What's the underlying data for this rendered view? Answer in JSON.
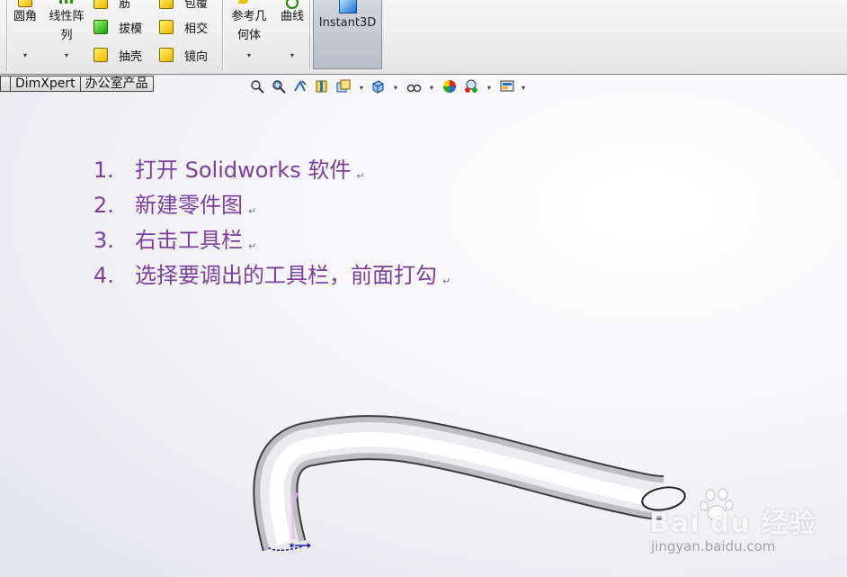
{
  "ribbon": {
    "fillet": {
      "label": "圆角"
    },
    "linear_pattern": {
      "label_line1": "线性阵",
      "label_line2": "列"
    },
    "rib": {
      "label": "筋"
    },
    "draft": {
      "label": "拔模"
    },
    "shell": {
      "label": "抽壳"
    },
    "wrap": {
      "label": "包覆"
    },
    "intersect": {
      "label": "相交"
    },
    "mirror": {
      "label": "镜向"
    },
    "reference_geometry": {
      "label_line1": "参考几",
      "label_line2": "何体"
    },
    "curves": {
      "label": "曲线"
    },
    "instant3d": {
      "label": "Instant3D"
    },
    "dropdown_glyph": "▾"
  },
  "tabs": [
    {
      "label": ""
    },
    {
      "label": "DimXpert"
    },
    {
      "label": "办公室产品"
    }
  ],
  "steps": [
    {
      "num": "1.",
      "text": "打开 Solidworks 软件"
    },
    {
      "num": "2.",
      "text": "新建零件图"
    },
    {
      "num": "3.",
      "text": "右击工具栏"
    },
    {
      "num": "4.",
      "text": "选择要调出的工具栏，前面打勾"
    }
  ],
  "paragraph_mark": "↵",
  "watermark": {
    "main": "Bai du 经验",
    "sub": "jingyan.baidu.com"
  },
  "colors": {
    "step_text": "#7a3e9d",
    "ribbon_bg": "#eeeeee",
    "instant3d_active": "#c4c9d2"
  },
  "icons": [
    "zoom-fit-icon",
    "zoom-area-icon",
    "previous-view-icon",
    "section-view-icon",
    "view-orientation-icon",
    "display-style-icon",
    "hide-show-icon",
    "appearance-icon",
    "scene-icon",
    "view-settings-icon"
  ]
}
